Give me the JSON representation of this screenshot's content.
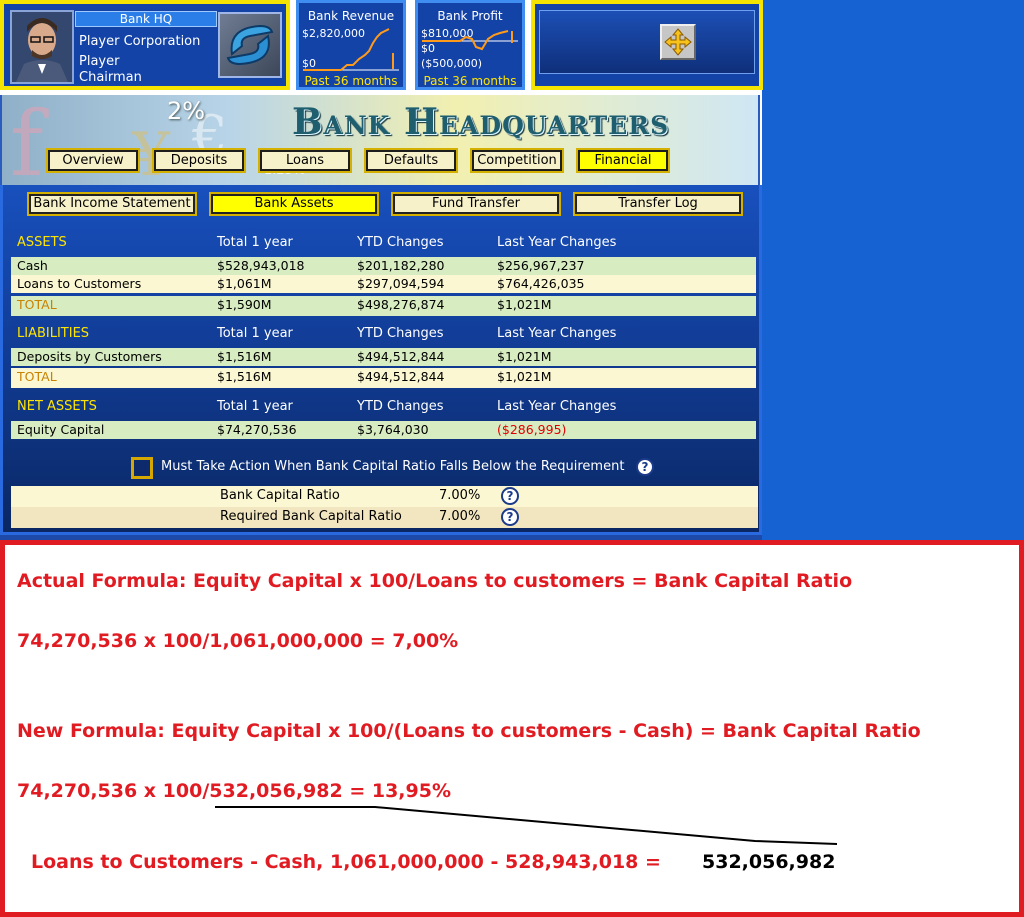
{
  "header": {
    "hq_title": "Bank HQ",
    "company": "Player Corporation",
    "player_name": "Player",
    "player_role": "Chairman"
  },
  "revenue_panel": {
    "title": "Bank Revenue",
    "top_value": "$2,820,000",
    "bottom_value": "$0",
    "footer": "Past 36 months"
  },
  "profit_panel": {
    "title": "Bank Profit",
    "top_value": "$810,000",
    "mid_value": "$0",
    "bottom_value": "($500,000)",
    "footer": "Past 36 months"
  },
  "banner": {
    "title": "Bank Headquarters",
    "deco_pct": "2%",
    "deco_small": "1.25%"
  },
  "tabs": [
    {
      "label": "Overview"
    },
    {
      "label": "Deposits"
    },
    {
      "label": "Loans"
    },
    {
      "label": "Defaults"
    },
    {
      "label": "Competition"
    },
    {
      "label": "Financial"
    }
  ],
  "subtabs": [
    {
      "label": "Bank Income Statement"
    },
    {
      "label": "Bank Assets"
    },
    {
      "label": "Fund Transfer"
    },
    {
      "label": "Transfer Log"
    }
  ],
  "columns": {
    "total": "Total 1 year",
    "ytd": "YTD Changes",
    "last": "Last Year Changes"
  },
  "assets": {
    "heading": "ASSETS",
    "rows": [
      {
        "label": "Cash",
        "total": "$528,943,018",
        "ytd": "$201,182,280",
        "last": "$256,967,237"
      },
      {
        "label": "Loans to Customers",
        "total": "$1,061M",
        "ytd": "$297,094,594",
        "last": "$764,426,035"
      },
      {
        "label": "TOTAL",
        "total": "$1,590M",
        "ytd": "$498,276,874",
        "last": "$1,021M"
      }
    ]
  },
  "liabilities": {
    "heading": "LIABILITIES",
    "rows": [
      {
        "label": "Deposits by Customers",
        "total": "$1,516M",
        "ytd": "$494,512,844",
        "last": "$1,021M"
      },
      {
        "label": "TOTAL",
        "total": "$1,516M",
        "ytd": "$494,512,844",
        "last": "$1,021M"
      }
    ]
  },
  "net_assets": {
    "heading": "NET ASSETS",
    "rows": [
      {
        "label": "Equity Capital",
        "total": "$74,270,536",
        "ytd": "$3,764,030",
        "last": "($286,995)"
      }
    ]
  },
  "capital": {
    "checkbox_label": "Must Take Action When Bank Capital Ratio Falls Below the Requirement",
    "ratio_label": "Bank Capital Ratio",
    "ratio_value": "7.00%",
    "required_label": "Required Bank Capital Ratio",
    "required_value": "7.00%",
    "help_glyph": "?"
  },
  "annotation": {
    "line1": "Actual Formula: Equity Capital x 100/Loans to customers = Bank Capital Ratio",
    "line2": "74,270,536 x 100/1,061,000,000 = 7,00%",
    "line3": "New Formula: Equity Capital x 100/(Loans to customers - Cash) = Bank Capital Ratio",
    "line4": "74,270,536 x 100/532,056,982 = 13,95%",
    "line5_red": "Loans to Customers - Cash, 1,061,000,000 - 528,943,018 =",
    "line5_black": "532,056,982"
  },
  "colors": {
    "accent_yellow": "#f4e400",
    "panel_blue": "#1443a8",
    "annotation_red": "#e11b22",
    "negative_red": "#e10000"
  }
}
